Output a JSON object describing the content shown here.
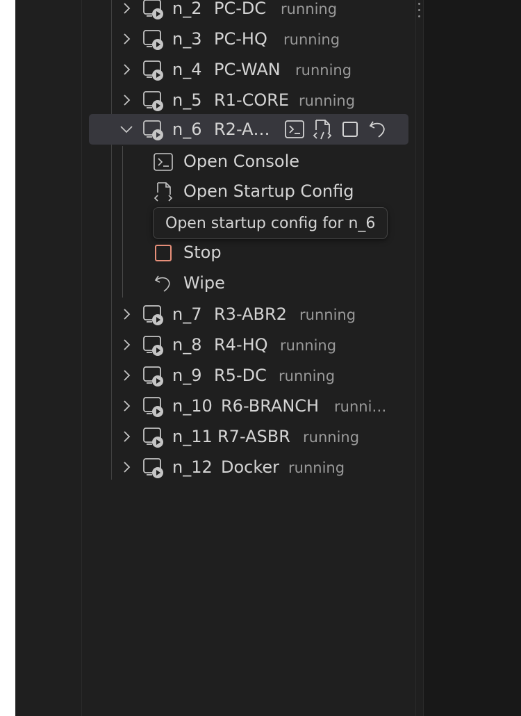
{
  "colors": {
    "background": "#181818",
    "panel": "#1f1f1f",
    "selected_row": "#37373d",
    "text": "#d4d4d4",
    "muted": "#9a9a9a",
    "stop_accent": "#e8907a"
  },
  "nodes": [
    {
      "id": "n_2",
      "name": "PC-DC",
      "status": "running"
    },
    {
      "id": "n_3",
      "name": "PC-HQ",
      "status": "running"
    },
    {
      "id": "n_4",
      "name": "PC-WAN",
      "status": "running"
    },
    {
      "id": "n_5",
      "name": "R1-CORE",
      "status": "running"
    },
    {
      "id": "n_6",
      "name": "R2-A…",
      "status": ""
    },
    {
      "id": "n_7",
      "name": "R3-ABR2",
      "status": "running"
    },
    {
      "id": "n_8",
      "name": "R4-HQ",
      "status": "running"
    },
    {
      "id": "n_9",
      "name": "R5-DC",
      "status": "running"
    },
    {
      "id": "n_10",
      "name": "R6-BRANCH",
      "status": "runni…"
    },
    {
      "id": "n_11",
      "name": "R7-ASBR",
      "status": "running"
    },
    {
      "id": "n_12",
      "name": "Docker",
      "status": "running"
    }
  ],
  "expanded_actions": [
    {
      "label": "Open Console",
      "icon": "terminal-icon"
    },
    {
      "label": "Open Startup Config",
      "icon": "file-code-icon"
    },
    {
      "label": "Stop",
      "icon": "stop-square-icon"
    },
    {
      "label": "Wipe",
      "icon": "undo-icon"
    }
  ],
  "tooltip": "Open startup config for n_6"
}
